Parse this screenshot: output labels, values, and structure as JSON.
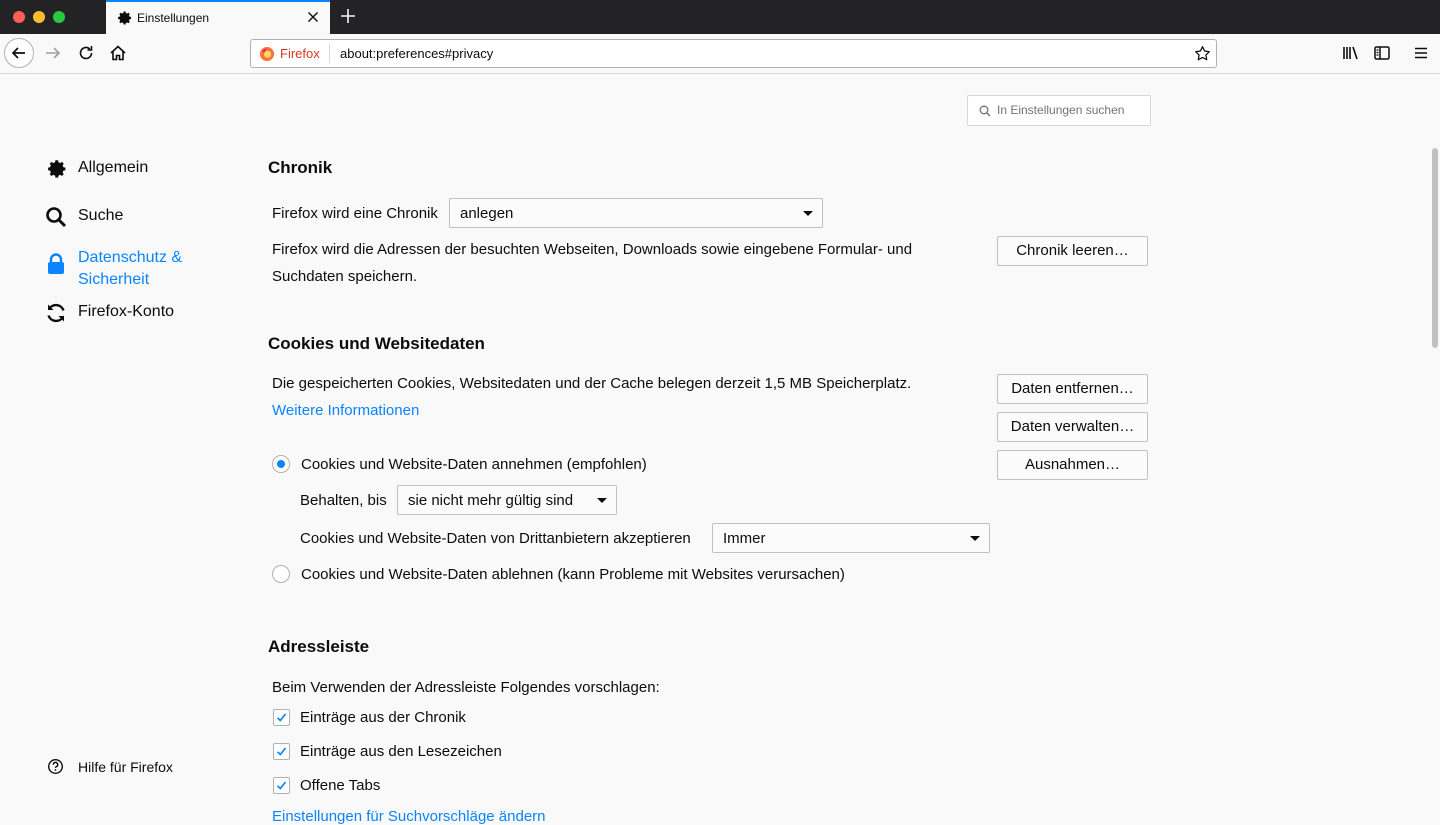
{
  "tab": {
    "title": "Einstellungen"
  },
  "urlbar": {
    "identity": "Firefox",
    "url": "about:preferences#privacy"
  },
  "search": {
    "placeholder": "In Einstellungen suchen"
  },
  "sidebar": {
    "items": [
      {
        "label": "Allgemein",
        "icon": "gear-icon"
      },
      {
        "label": "Suche",
        "icon": "search-icon"
      },
      {
        "label": "Datenschutz & Sicherheit",
        "icon": "lock-icon",
        "active": true
      },
      {
        "label": "Firefox-Konto",
        "icon": "sync-icon"
      }
    ],
    "help": "Hilfe für Firefox"
  },
  "history": {
    "heading": "Chronik",
    "mode_label": "Firefox wird eine Chronik",
    "mode_value": "anlegen",
    "description": "Firefox wird die Adressen der besuchten Webseiten, Downloads sowie eingebene Formular- und Suchdaten speichern.",
    "clear_button": "Chronik leeren…"
  },
  "cookies": {
    "heading": "Cookies und Websitedaten",
    "usage_text": "Die gespeicherten Cookies, Websitedaten und der Cache belegen derzeit 1,5 MB Speicherplatz.",
    "more_info": "Weitere Informationen",
    "remove_button": "Daten entfernen…",
    "manage_button": "Daten verwalten…",
    "exceptions_button": "Ausnahmen…",
    "accept_label": "Cookies und Website-Daten annehmen (empfohlen)",
    "keep_label": "Behalten, bis",
    "keep_value": "sie nicht mehr gültig sind",
    "third_party_label": "Cookies und Website-Daten von Drittanbietern akzeptieren",
    "third_party_value": "Immer",
    "block_label": "Cookies und Website-Daten ablehnen (kann Probleme mit Websites verursachen)"
  },
  "addressbar": {
    "heading": "Adressleiste",
    "intro": "Beim Verwenden der Adressleiste Folgendes vorschlagen:",
    "options": [
      {
        "label": "Einträge aus der Chronik",
        "checked": true
      },
      {
        "label": "Einträge aus den Lesezeichen",
        "checked": true
      },
      {
        "label": "Offene Tabs",
        "checked": true
      }
    ],
    "suggest_link": "Einstellungen für Suchvorschläge ändern"
  },
  "colors": {
    "accent": "#0a84ff",
    "identity": "#d73a20"
  }
}
